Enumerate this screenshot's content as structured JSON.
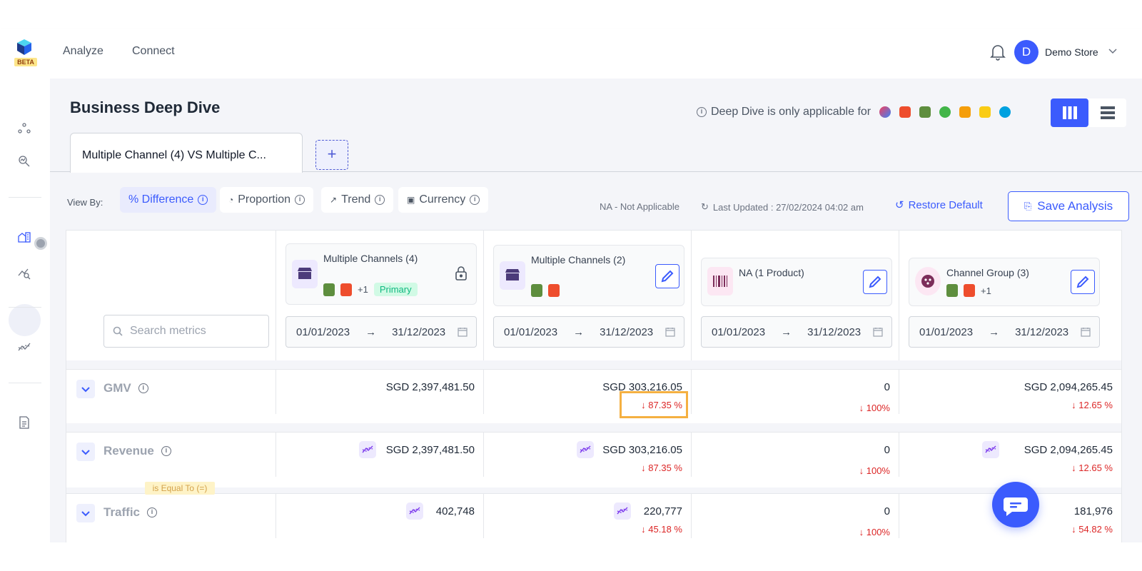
{
  "topbar": {
    "beta_label": "BETA",
    "nav": [
      "Analyze",
      "Connect"
    ],
    "avatar_letter": "D",
    "store_name": "Demo Store"
  },
  "page": {
    "title": "Business Deep Dive",
    "note": "Deep Dive is only applicable for",
    "tab_label": "Multiple Channel (4) VS Multiple C...",
    "add_tab": "+"
  },
  "toolbar": {
    "view_by": "View By:",
    "chips": [
      "% Difference",
      "Proportion",
      "Trend",
      "Currency"
    ],
    "na_note": "NA - Not Applicable",
    "last_updated": "Last Updated : 27/02/2024 04:02 am",
    "restore": "Restore Default",
    "save": "Save Analysis"
  },
  "search": {
    "placeholder": "Search metrics"
  },
  "columns": [
    {
      "name": "Multiple Channels (4)",
      "extra": "+1",
      "badge": "Primary",
      "start": "01/01/2023",
      "end": "31/12/2023"
    },
    {
      "name": "Multiple Channels (2)",
      "extra": "",
      "badge": "",
      "start": "01/01/2023",
      "end": "31/12/2023"
    },
    {
      "name": "NA (1 Product)",
      "extra": "",
      "badge": "",
      "start": "01/01/2023",
      "end": "31/12/2023"
    },
    {
      "name": "Channel Group (3)",
      "extra": "+1",
      "badge": "",
      "start": "01/01/2023",
      "end": "31/12/2023"
    }
  ],
  "date_arrow": "→",
  "rows": [
    {
      "label": "GMV",
      "values": [
        "SGD 2,397,481.50",
        "SGD 303,216.05",
        "0",
        "SGD 2,094,265.45"
      ],
      "changes": [
        "",
        "↓ 87.35 %",
        "↓ 100%",
        "↓ 12.65 %"
      ]
    },
    {
      "label": "Revenue",
      "values": [
        "SGD 2,397,481.50",
        "SGD 303,216.05",
        "0",
        "SGD 2,094,265.45"
      ],
      "changes": [
        "",
        "↓ 87.35 %",
        "↓ 100%",
        "↓ 12.65 %"
      ]
    },
    {
      "label": "Traffic",
      "values": [
        "402,748",
        "220,777",
        "0",
        "181,976"
      ],
      "changes": [
        "",
        "↓ 45.18 %",
        "↓ 100%",
        "↓ 54.82 %"
      ]
    }
  ],
  "tooltip": "is Equal To (=)",
  "colors": {
    "accent": "#3b5bfd",
    "negative": "#dc2626",
    "highlight": "#f5b041",
    "primary_badge": "#10b981"
  },
  "icons": {
    "platforms": [
      "lazada-icon",
      "shopee-icon",
      "shopify-icon",
      "tokopedia-icon",
      "amazon-icon",
      "flipkart-icon",
      "salesforce-icon"
    ]
  }
}
